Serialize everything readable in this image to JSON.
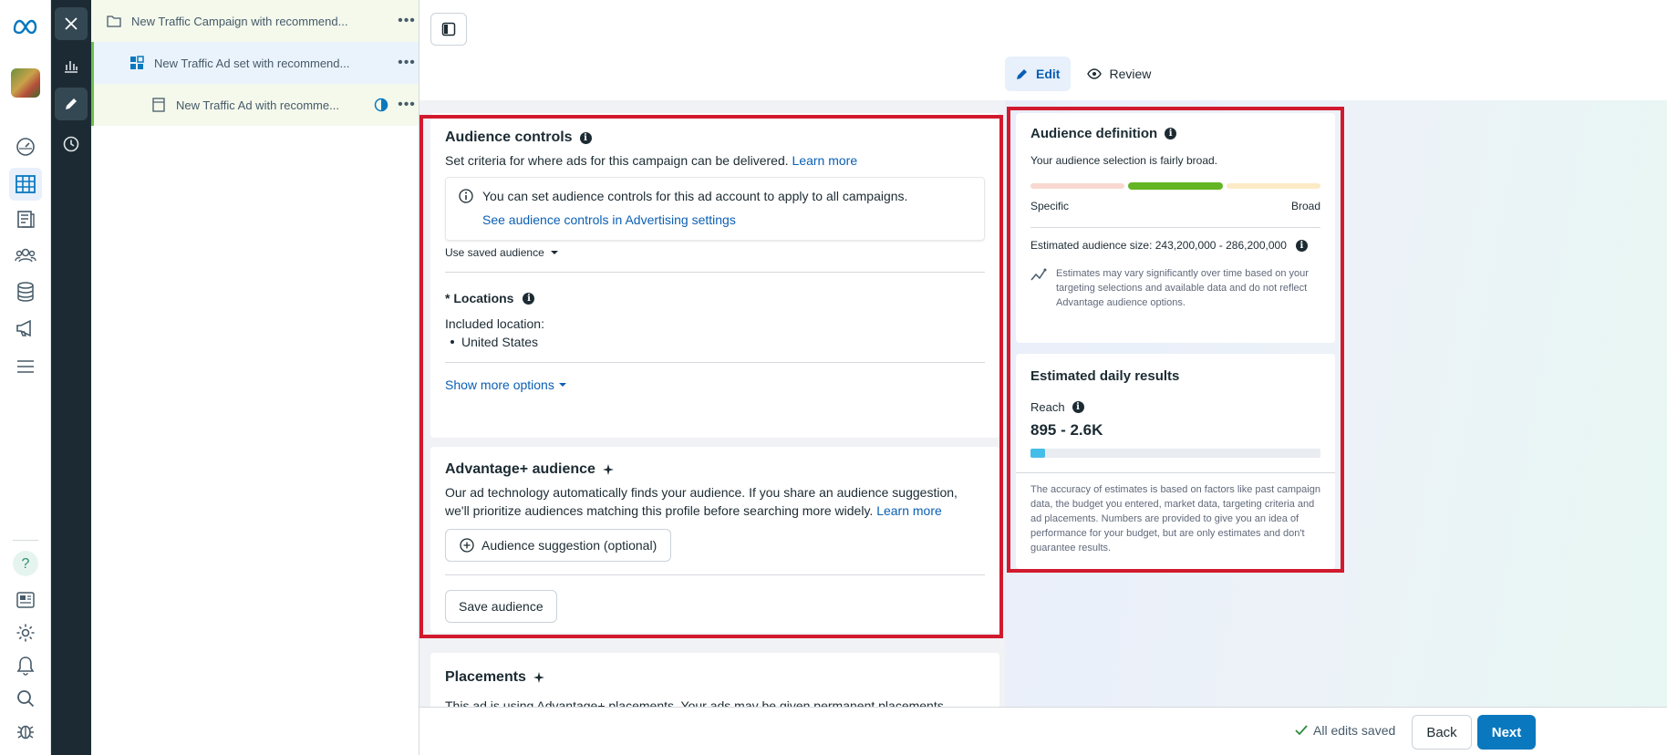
{
  "tree": {
    "campaign": {
      "label": "New Traffic Campaign with recommend...",
      "menu": "•••"
    },
    "adset": {
      "label": "New Traffic Ad set with recommend...",
      "menu": "•••"
    },
    "ad": {
      "label": "New Traffic Ad with recomme...",
      "menu": "•••"
    }
  },
  "tabs": {
    "edit": "Edit",
    "review": "Review"
  },
  "audience_controls": {
    "title": "Audience controls",
    "description": "Set criteria for where ads for this campaign can be delivered.",
    "learn_more": "Learn more",
    "notice_text": "You can set audience controls for this ad account to apply to all campaigns.",
    "notice_link": "See audience controls in Advertising settings",
    "saved_audience": "Use saved audience",
    "locations_title": "* Locations",
    "included_label": "Included location:",
    "location_item": "United States",
    "show_more": "Show more options"
  },
  "advantage": {
    "title": "Advantage+ audience",
    "description": "Our ad technology automatically finds your audience. If you share an audience suggestion, we'll prioritize audiences matching this profile before searching more widely.",
    "learn_more": "Learn more",
    "suggestion_button": "Audience suggestion (optional)",
    "save_button": "Save audience"
  },
  "placements": {
    "title": "Placements",
    "description": "This ad is using Advantage+ placements. Your ads may be given permanent placements..."
  },
  "audience_definition": {
    "title": "Audience definition",
    "status": "Your audience selection is fairly broad.",
    "specific_label": "Specific",
    "broad_label": "Broad",
    "size_text": "Estimated audience size: 243,200,000 - 286,200,000",
    "note": "Estimates may vary significantly over time based on your targeting selections and available data and do not reflect Advantage audience options."
  },
  "daily_results": {
    "title": "Estimated daily results",
    "reach_label": "Reach",
    "reach_value": "895 - 2.6K",
    "reach_fill_fraction": 0.05,
    "disclaimer": "The accuracy of estimates is based on factors like past campaign data, the budget you entered, market data, targeting criteria and ad placements. Numbers are provided to give you an idea of performance for your budget, but are only estimates and don't guarantee results."
  },
  "footer": {
    "saved_text": "All edits saved",
    "back": "Back",
    "next": "Next"
  },
  "colors": {
    "accent_blue": "#0a78be",
    "link_blue": "#0a5fb4",
    "highlight_red": "#d21a2e",
    "meter_green": "#63b523"
  }
}
